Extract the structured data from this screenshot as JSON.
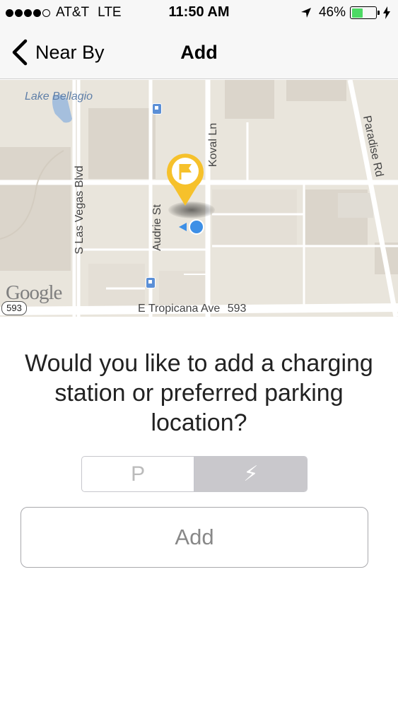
{
  "status_bar": {
    "carrier": "AT&T",
    "network": "LTE",
    "time": "11:50 AM",
    "battery_percent": "46%",
    "battery_level": 0.46,
    "icons": [
      "signal-dots-icon",
      "location-arrow-icon",
      "battery-icon",
      "charging-bolt-icon"
    ]
  },
  "nav": {
    "back_label": "Near By",
    "title": "Add",
    "back_icon": "chevron-left-icon"
  },
  "map": {
    "labels": {
      "lake": "Lake Bellagio",
      "las_vegas_blvd": "S Las Vegas Blvd",
      "audrie_st": "Audrie St",
      "koval_ln": "Koval Ln",
      "paradise_rd": "Paradise Rd",
      "tropicana": "E Tropicana Ave",
      "tropicana_num": "593",
      "route_shield": "593",
      "google": "Google"
    },
    "marker_icon": "flag-pin-icon",
    "user_location_icon": "user-location-icon",
    "transit_icon": "bus-stop-icon",
    "colors": {
      "land": "#e9e5dc",
      "road": "#ffffff",
      "water": "#a5bfdd",
      "marker": "#f6c12b",
      "user_dot": "#3d8fe6"
    }
  },
  "question": "Would you like to add a charging station or preferred parking location?",
  "segmented": {
    "options": [
      {
        "label": "P",
        "selected": false
      },
      {
        "label": "⚡",
        "selected": true
      }
    ],
    "parking_icon": "parking-icon",
    "charging_icon": "lightning-bolt-icon"
  },
  "add_button": {
    "label": "Add"
  }
}
